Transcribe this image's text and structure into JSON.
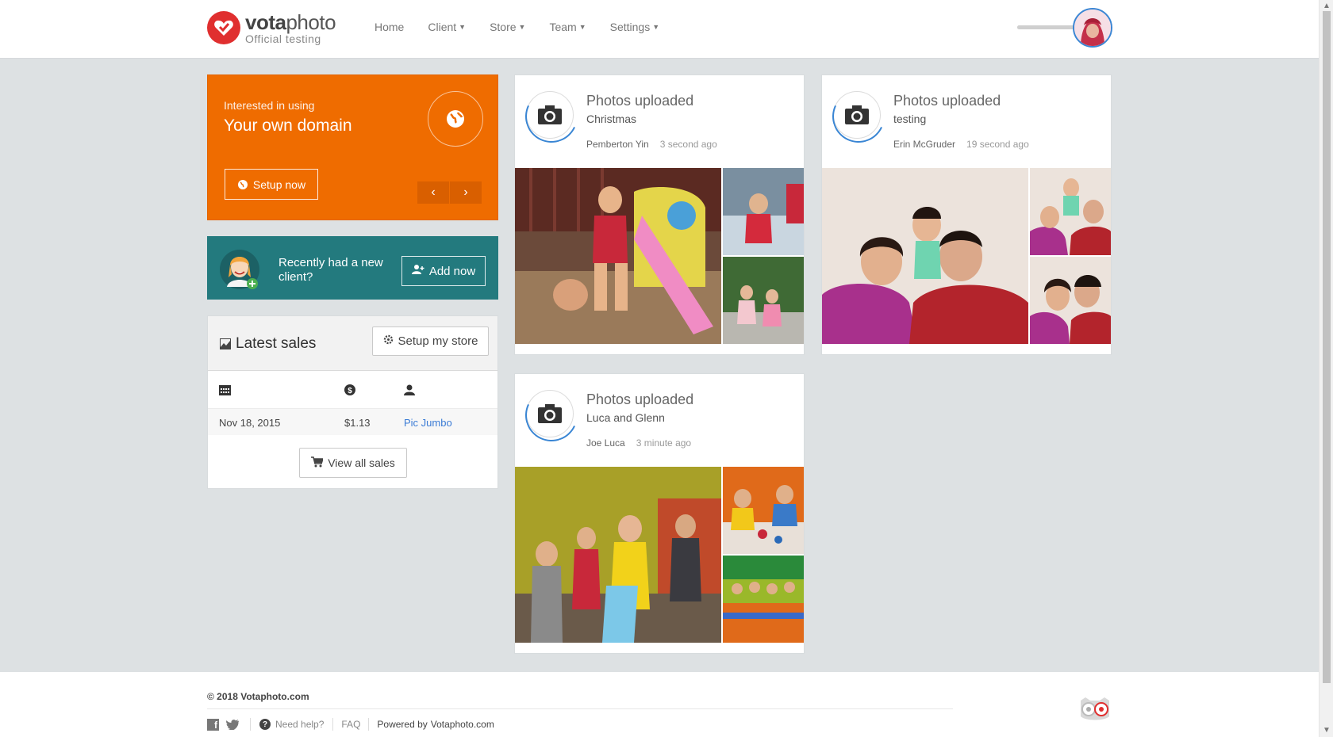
{
  "header": {
    "logo_bold": "vota",
    "logo_rest": "photo",
    "logo_sub": "Official testing",
    "nav": [
      {
        "label": "Home",
        "dropdown": false
      },
      {
        "label": "Client",
        "dropdown": true
      },
      {
        "label": "Store",
        "dropdown": true
      },
      {
        "label": "Team",
        "dropdown": true
      },
      {
        "label": "Settings",
        "dropdown": true
      }
    ]
  },
  "promo": {
    "small": "Interested in using",
    "big": "Your own domain",
    "button": "Setup now"
  },
  "client": {
    "text": "Recently had a new client?",
    "button": "Add now"
  },
  "sales": {
    "title": "Latest sales",
    "setup_button": "Setup my store",
    "rows": [
      {
        "date": "Nov 18, 2015",
        "amount": "$1.13",
        "customer": "Pic Jumbo"
      }
    ],
    "view_all": "View all sales"
  },
  "feed": [
    {
      "title": "Photos uploaded",
      "album": "Christmas",
      "user": "Pemberton Yin",
      "time": "3 second ago"
    },
    {
      "title": "Photos uploaded",
      "album": "testing",
      "user": "Erin McGruder",
      "time": "19 second ago"
    },
    {
      "title": "Photos uploaded",
      "album": "Luca and Glenn",
      "user": "Joe Luca",
      "time": "3 minute ago"
    }
  ],
  "footer": {
    "copyright": "© 2018 Votaphoto.com",
    "need_help": "Need help?",
    "faq": "FAQ",
    "powered_prefix": "Powered by",
    "powered_link": "Votaphoto.com"
  },
  "colors": {
    "orange": "#ef6c00",
    "teal": "#237a7e",
    "brand_red": "#e02f2f",
    "link_blue": "#3a7bd5"
  }
}
